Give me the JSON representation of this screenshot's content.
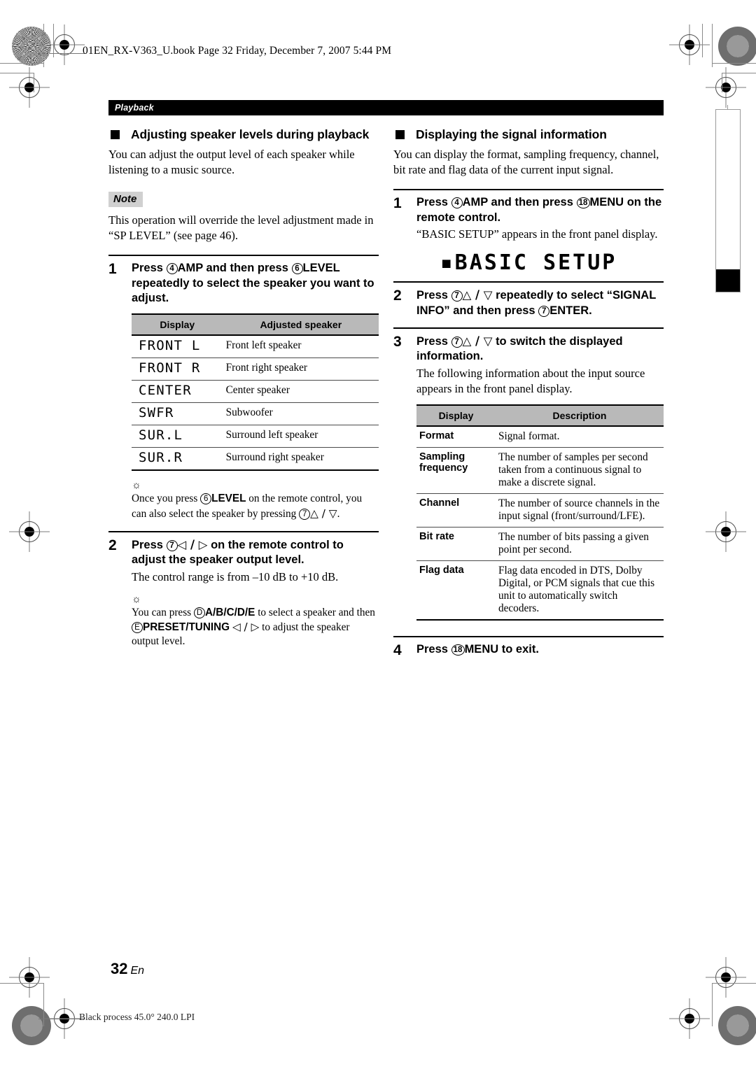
{
  "print_marks": {
    "running_head": "01EN_RX-V363_U.book  Page 32  Friday, December 7, 2007  5:44 PM",
    "color_bar_note": "Black process 45.0° 240.0 LPI"
  },
  "section_bar": {
    "label": "Playback"
  },
  "left_column": {
    "heading": "Adjusting speaker levels during playback",
    "intro": "You can adjust the output level of each speaker while listening to a music source.",
    "note_label": "Note",
    "note_text": "This operation will override the level adjustment made in “SP LEVEL” (see page 46).",
    "step1": {
      "number": "1",
      "lead_parts": {
        "press": "Press",
        "btn1_circle": "4",
        "btn1": "AMP",
        "mid": "and then press",
        "btn2_circle": "6",
        "btn2": "LEVEL",
        "tail": "repeatedly to select the speaker you want to adjust."
      }
    },
    "table": {
      "headers": [
        "Display",
        "Adjusted speaker"
      ],
      "rows": [
        {
          "display": "FRONT L",
          "desc": "Front left speaker"
        },
        {
          "display": "FRONT R",
          "desc": "Front right speaker"
        },
        {
          "display": "CENTER",
          "desc": "Center speaker"
        },
        {
          "display": "SWFR",
          "desc": "Subwoofer"
        },
        {
          "display": "SUR.L",
          "desc": "Surround left speaker"
        },
        {
          "display": "SUR.R",
          "desc": "Surround right speaker"
        }
      ]
    },
    "tip1": {
      "part1": "Once you press",
      "circle1": "6",
      "bold1": "LEVEL",
      "part2": "on the remote control, you can also select the speaker by pressing",
      "circle2": "7",
      "arrows": "△ / ▽",
      "period": "."
    },
    "step2": {
      "number": "2",
      "press": "Press",
      "circle": "7",
      "arrows": "◁ / ▷",
      "lead_tail": "on the remote control to adjust the speaker output level.",
      "sub": "The control range is from –10 dB to +10 dB."
    },
    "tip2": {
      "part1": "You can press",
      "circle1": "D",
      "bold1": "A/B/C/D/E",
      "part2": "to select a speaker and then",
      "circle2": "E",
      "bold2": "PRESET/TUNING",
      "arrows": "◁ / ▷",
      "part3": "to adjust the speaker output level."
    }
  },
  "right_column": {
    "heading": "Displaying the signal information",
    "intro": "You can display the format, sampling frequency, channel, bit rate and flag data of the current input signal.",
    "step1": {
      "number": "1",
      "press": "Press",
      "circle1": "4",
      "bold1": "AMP",
      "mid": "and then press",
      "circle2": "18",
      "bold2": "MENU",
      "tail": "on the remote control.",
      "sub": "“BASIC SETUP” appears in the front panel display."
    },
    "lcd_display": "▪BASIC SETUP",
    "step2": {
      "number": "2",
      "press": "Press",
      "circle": "7",
      "arrows": "△ / ▽",
      "mid": "repeatedly to select “SIGNAL INFO” and then press",
      "circle2": "7",
      "bold2": "ENTER",
      "period": "."
    },
    "step3": {
      "number": "3",
      "press": "Press",
      "circle": "7",
      "arrows": "△ / ▽",
      "tail": "to switch the displayed information.",
      "sub": "The following information about the input source appears in the front panel display."
    },
    "table": {
      "headers": [
        "Display",
        "Description"
      ],
      "rows": [
        {
          "display": "Format",
          "desc": "Signal format."
        },
        {
          "display": "Sampling frequency",
          "desc": "The number of samples per second taken from a continuous signal to make a discrete signal."
        },
        {
          "display": "Channel",
          "desc": "The number of source channels in the input signal (front/surround/LFE)."
        },
        {
          "display": "Bit rate",
          "desc": "The number of bits passing a given point per second."
        },
        {
          "display": "Flag data",
          "desc": "Flag data encoded in DTS, Dolby Digital, or PCM signals that cue this unit to automatically switch decoders."
        }
      ]
    },
    "step4": {
      "number": "4",
      "press": "Press",
      "circle": "18",
      "bold": "MENU",
      "tail": "to exit."
    }
  },
  "folio": {
    "page_number": "32",
    "lang": "En"
  }
}
